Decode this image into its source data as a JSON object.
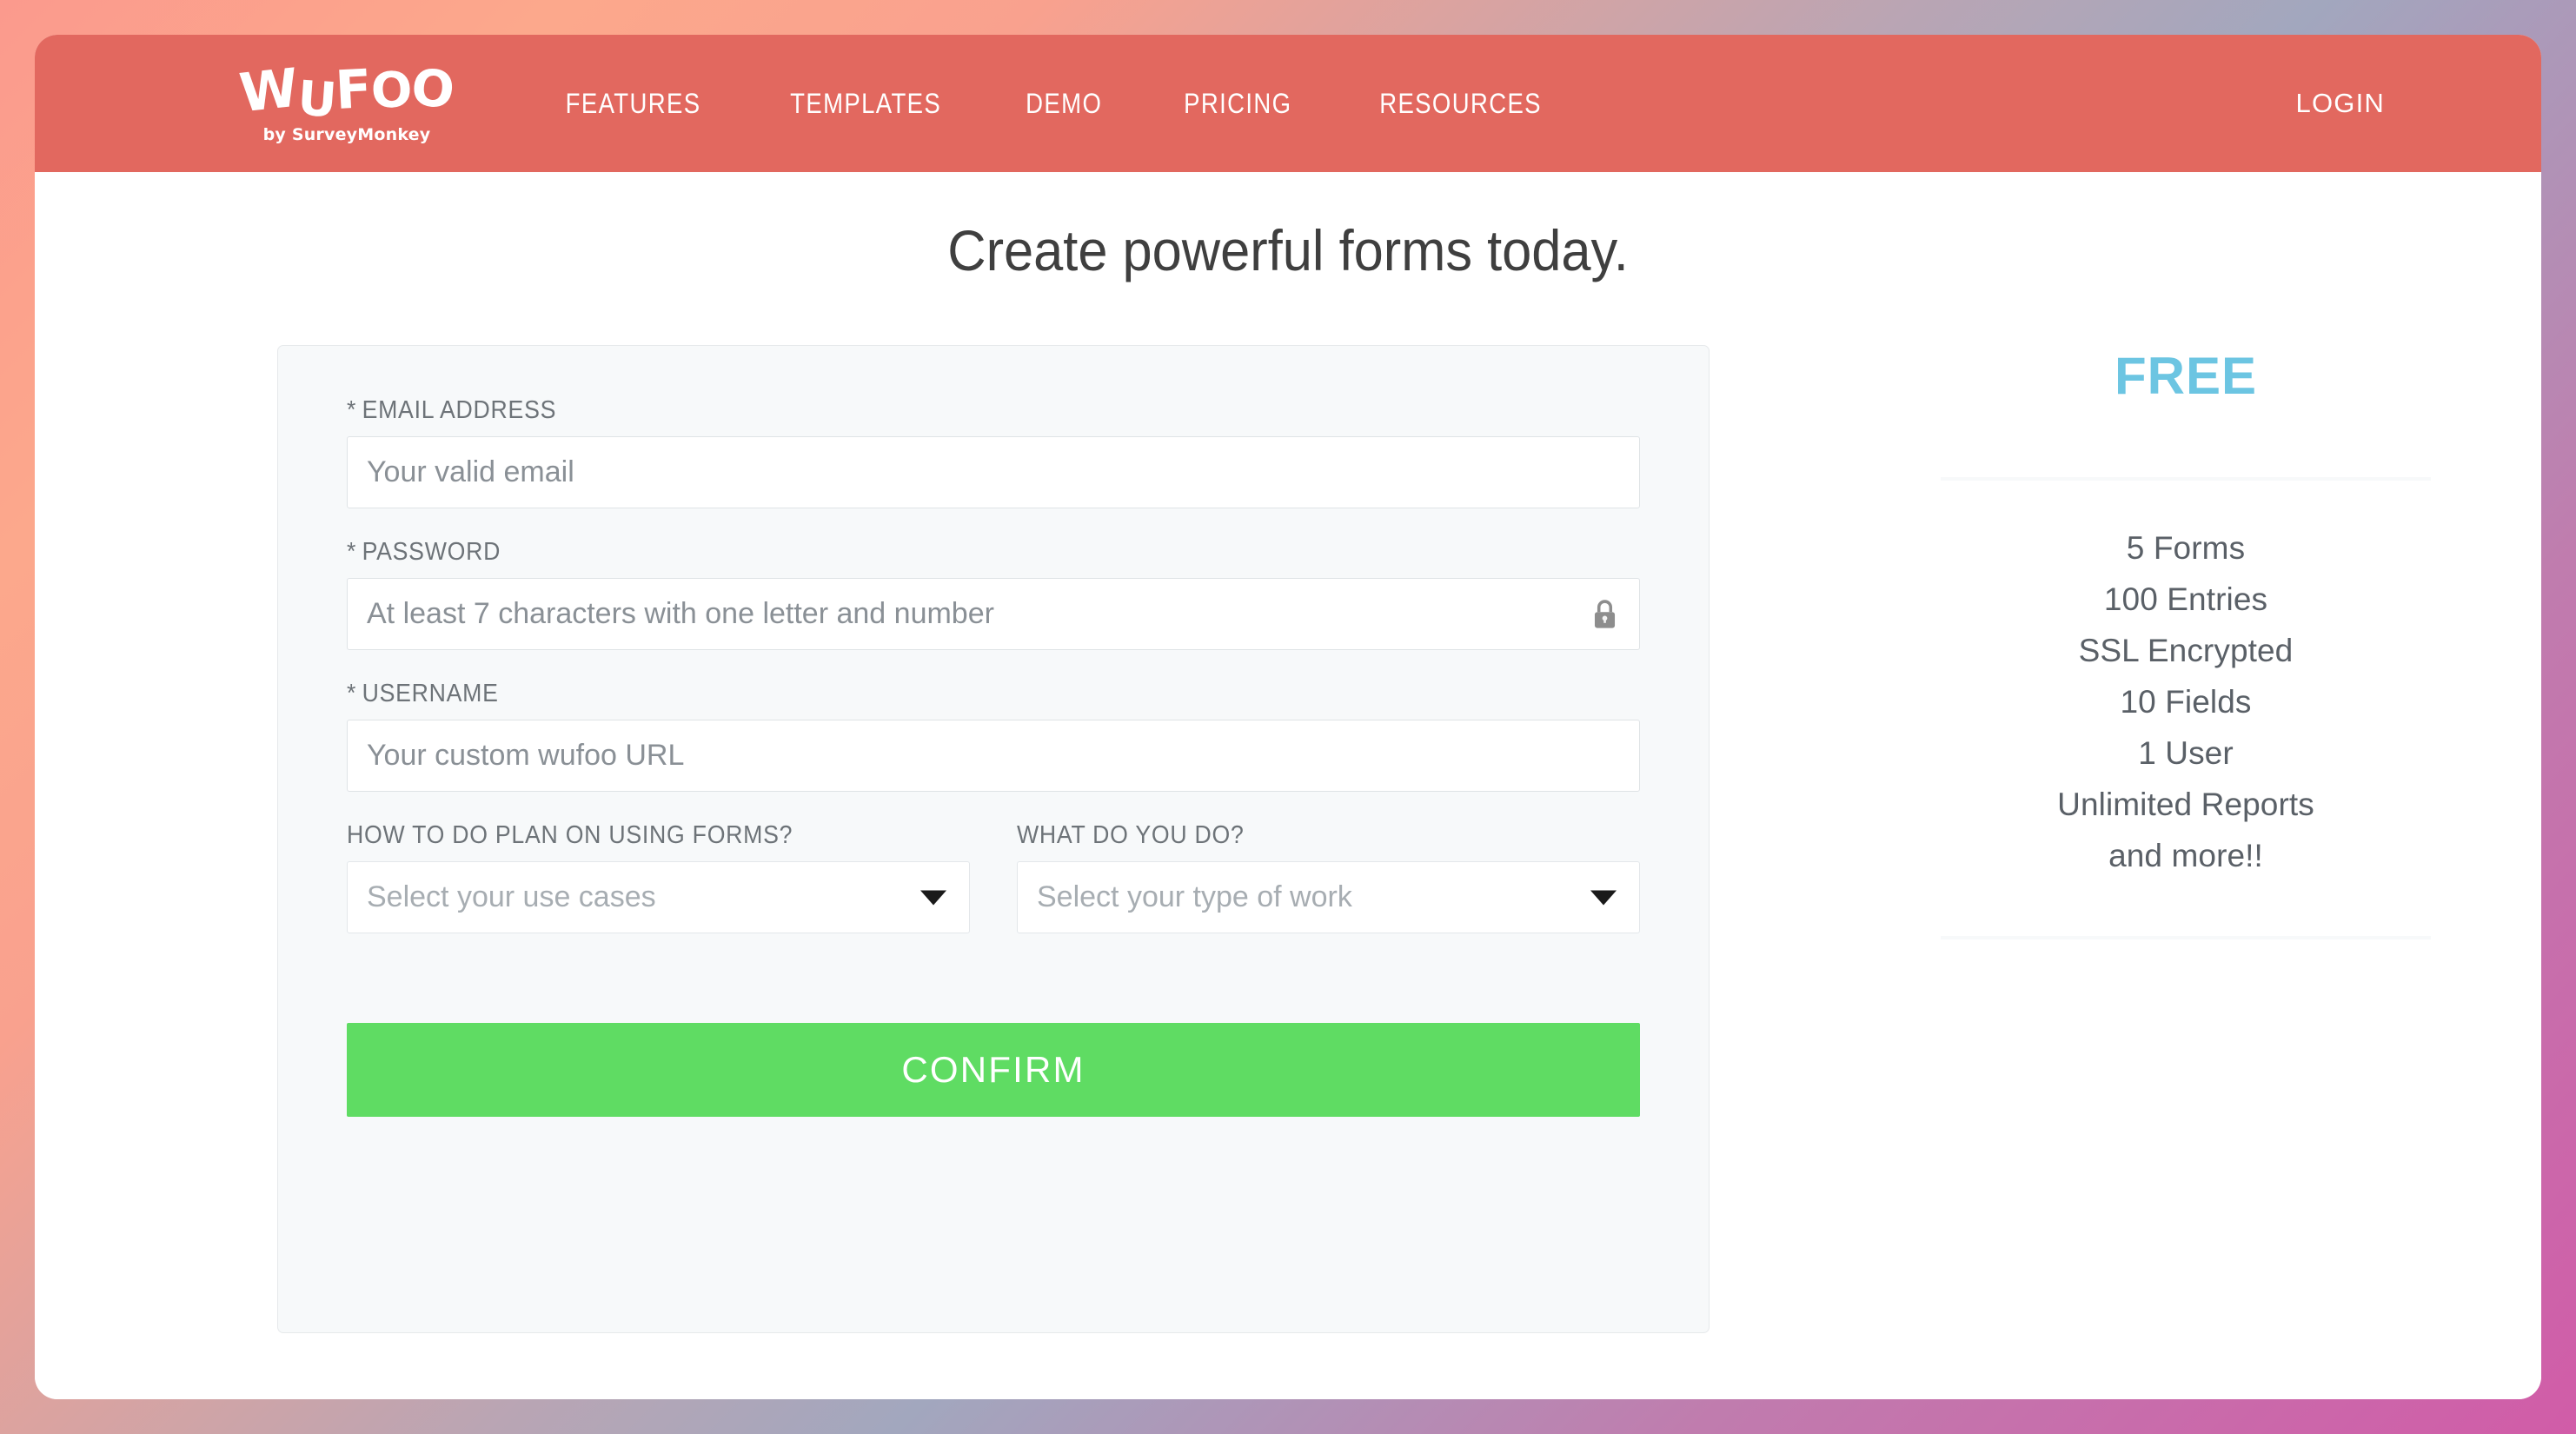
{
  "header": {
    "logo_word": "WUFOO",
    "logo_letters": [
      "W",
      "U",
      "F",
      "O",
      "O"
    ],
    "logo_subtitle": "by SurveyMonkey",
    "brand_color": "#E2685F",
    "nav": [
      {
        "label": "FEATURES",
        "name": "features"
      },
      {
        "label": "TEMPLATES",
        "name": "templates"
      },
      {
        "label": "DEMO",
        "name": "demo"
      },
      {
        "label": "PRICING",
        "name": "pricing"
      },
      {
        "label": "RESOURCES",
        "name": "resources"
      }
    ],
    "login_label": "LOGIN"
  },
  "page": {
    "title": "Create powerful forms today."
  },
  "form": {
    "email": {
      "label": "EMAIL ADDRESS",
      "required_marker": "*",
      "placeholder": "Your valid email",
      "value": ""
    },
    "password": {
      "label": "PASSWORD",
      "required_marker": "*",
      "placeholder": "At least 7 characters with one letter and number",
      "value": "",
      "icon": "lock-icon"
    },
    "username": {
      "label": "USERNAME",
      "required_marker": "*",
      "placeholder": "Your custom wufoo URL",
      "value": ""
    },
    "use_case": {
      "label": "HOW TO DO PLAN ON USING FORMS?",
      "placeholder": "Select your use cases",
      "value": "Select your use cases",
      "icon": "chevron-down-icon"
    },
    "work_type": {
      "label": "WHAT DO YOU DO?",
      "placeholder": "Select your type of work",
      "value": "Select your type of work",
      "icon": "chevron-down-icon"
    },
    "submit_label": "CONFIRM",
    "submit_color": "#5FDC63"
  },
  "plan": {
    "name": "FREE",
    "name_color": "#6CC5E2",
    "features": [
      "5 Forms",
      "100 Entries",
      "SSL Encrypted",
      "10 Fields",
      "1 User",
      "Unlimited Reports",
      "and more!!"
    ]
  }
}
